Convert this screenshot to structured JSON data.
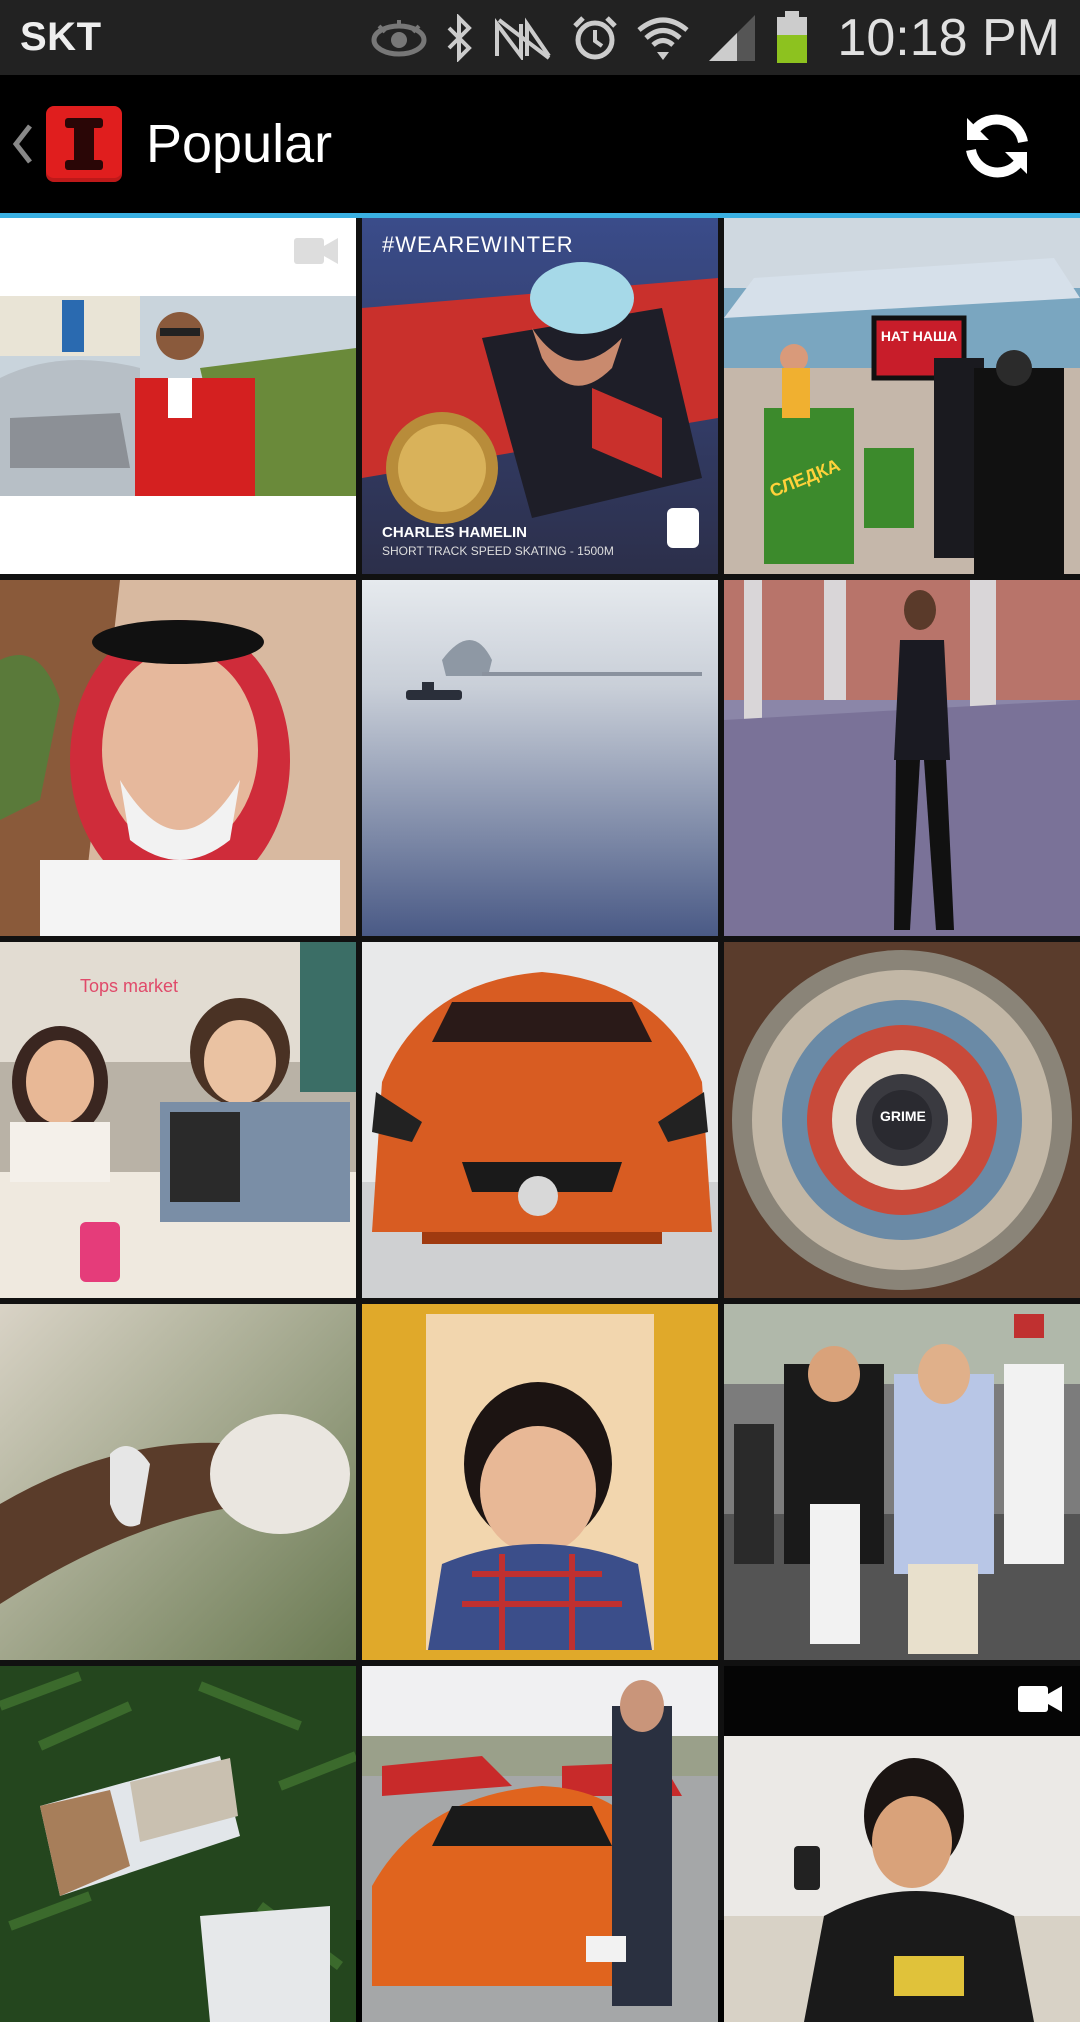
{
  "status_bar": {
    "carrier": "SKT",
    "time": "10:18 PM",
    "icons": [
      "eye-icon",
      "bluetooth-icon",
      "no-signal-icon",
      "alarm-icon",
      "wifi-icon",
      "cell-signal-icon",
      "battery-icon"
    ]
  },
  "app_bar": {
    "title": "Popular",
    "back_icon": "chevron-left-icon",
    "logo": "app-logo-icon",
    "refresh_icon": "refresh-icon"
  },
  "grid": {
    "tiles": [
      {
        "name": "tile-man-red-jacket",
        "video": true
      },
      {
        "name": "tile-we-are-winter",
        "hashtag": "#WEAREWINTER",
        "caption_name": "CHARLES HAMELIN",
        "caption_event": "SHORT TRACK SPEED SKATING - 1500M"
      },
      {
        "name": "tile-tv-studio",
        "sign1": "НАТ НАША",
        "sign2": "СЛЕДКА"
      },
      {
        "name": "tile-elder-man-keffiyeh"
      },
      {
        "name": "tile-misty-lake-boat"
      },
      {
        "name": "tile-woman-walking"
      },
      {
        "name": "tile-two-girls-cafe",
        "sign": "Tops market"
      },
      {
        "name": "tile-orange-sports-car"
      },
      {
        "name": "tile-sneaker-circle",
        "badge": "GRIME"
      },
      {
        "name": "tile-hand-bracelet"
      },
      {
        "name": "tile-boy-portrait"
      },
      {
        "name": "tile-street-protest"
      },
      {
        "name": "tile-photos-on-leaves"
      },
      {
        "name": "tile-ferrari-parking"
      },
      {
        "name": "tile-young-man-phone",
        "video": true
      }
    ]
  },
  "colors": {
    "accent": "#3ab0e2",
    "status_bar_bg": "#222222",
    "app_bar_bg": "#000000",
    "logo_red": "#e01e1e"
  }
}
